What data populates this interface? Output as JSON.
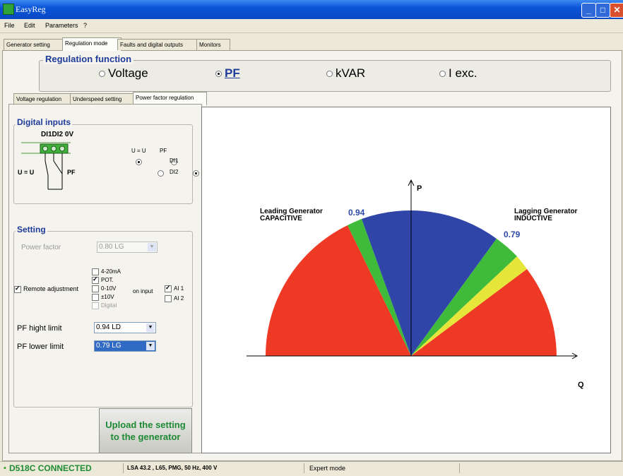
{
  "window": {
    "title": "EasyReg"
  },
  "menu": [
    "File",
    "Edit",
    "Parameters",
    "?"
  ],
  "main_tabs": [
    {
      "label": "Generator setting",
      "active": false
    },
    {
      "label": "Regulation mode",
      "active": true
    },
    {
      "label": "Faults and digital outputs",
      "active": false
    },
    {
      "label": "Monitors",
      "active": false
    }
  ],
  "regulation_function": {
    "title": "Regulation function",
    "options": [
      {
        "label": "Voltage",
        "selected": false
      },
      {
        "label": "PF",
        "selected": true
      },
      {
        "label": "kVAR",
        "selected": false
      },
      {
        "label": "I exc.",
        "selected": false
      }
    ]
  },
  "sub_tabs": [
    {
      "label": "Voltage regulation",
      "active": false
    },
    {
      "label": "Underspeed setting",
      "active": false
    },
    {
      "label": "Power factor regulation",
      "active": true
    }
  ],
  "digital_inputs": {
    "title": "Digital inputs",
    "terminal_label": "DI1DI2 0V",
    "switch_left": "U = U",
    "switch_right": "PF",
    "col_uu": "U = U",
    "col_pf": "PF",
    "row1": "DI1",
    "row2": "DI2"
  },
  "setting": {
    "title": "Setting",
    "power_factor_label": "Power factor",
    "power_factor_value": "0.80 LG",
    "remote_adjustment_label": "Remote adjustment",
    "remote_adjustment_checked": true,
    "input_options": [
      {
        "label": "4-20mA",
        "checked": false,
        "disabled": false
      },
      {
        "label": "POT.",
        "checked": true,
        "disabled": false
      },
      {
        "label": "0-10V",
        "checked": false,
        "disabled": false
      },
      {
        "label": "±10V",
        "checked": false,
        "disabled": false
      },
      {
        "label": "Digital",
        "checked": false,
        "disabled": true
      }
    ],
    "on_input_label": "on input",
    "ai_options": [
      {
        "label": "AI 1",
        "checked": true
      },
      {
        "label": "AI 2",
        "checked": false
      }
    ],
    "pf_high_label": "PF hight limit",
    "pf_high_value": "0.94 LD",
    "pf_low_label": "PF lower limit",
    "pf_low_value": "0.79 LG"
  },
  "upload_button": {
    "line1": "Upload the setting",
    "line2": "to the generator"
  },
  "chart": {
    "axis_p": "P",
    "axis_q": "Q",
    "leading_line1": "Leading Generator",
    "leading_line2": "CAPACITIVE",
    "lagging_line1": "Lagging Generator",
    "lagging_line2": "INDUCTIVE",
    "label_094": "0.94",
    "label_079": "0.79",
    "colors": {
      "red": "#ee3a24",
      "green": "#3fba3a",
      "blue": "#2f45a8",
      "yellow": "#e6e63a",
      "label": "#2c49a8"
    }
  },
  "status": {
    "connection": "D518C CONNECTED",
    "info": "LSA 43.2  , L65, PMG, 50 Hz, 400 V",
    "mode": "Expert mode"
  }
}
